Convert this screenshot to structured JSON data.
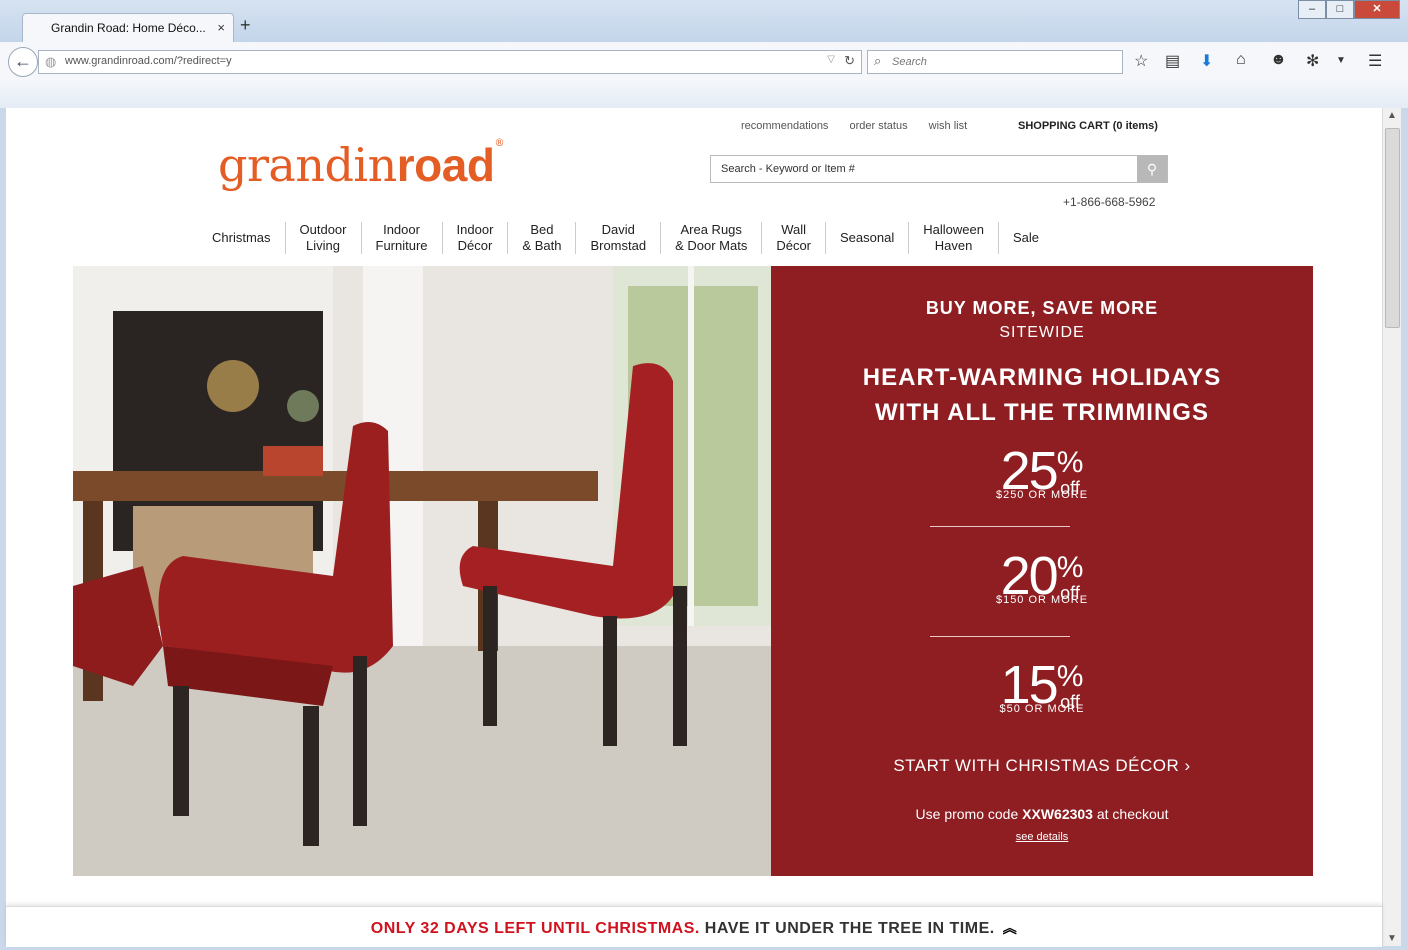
{
  "browser": {
    "tab_title": "Grandin Road: Home Déco...",
    "tab_close": "×",
    "new_tab": "+",
    "window_buttons": [
      "–",
      "□",
      "✕"
    ],
    "url": "www.grandinroad.com/?redirect=y",
    "search_placeholder": "Search",
    "icons": [
      "back-arrow-icon",
      "globe-icon",
      "reload-icon",
      "search-icon",
      "star-icon",
      "reading-list-icon",
      "download-icon",
      "home-icon",
      "chat-icon",
      "extension-icon",
      "menu-icon"
    ]
  },
  "site": {
    "top_links": [
      "recommendations",
      "order status",
      "wish list"
    ],
    "cart": "SHOPPING CART (0 items)",
    "logo_plain": "grandin",
    "logo_bold": "road",
    "logo_mark": "®",
    "search_placeholder": "Search - Keyword or Item #",
    "phone": "+1-866-668-5962",
    "categories": [
      {
        "line1": "Christmas",
        "line2": ""
      },
      {
        "line1": "Outdoor",
        "line2": "Living"
      },
      {
        "line1": "Indoor",
        "line2": "Furniture"
      },
      {
        "line1": "Indoor",
        "line2": "Décor"
      },
      {
        "line1": "Bed",
        "line2": "& Bath"
      },
      {
        "line1": "David",
        "line2": "Bromstad"
      },
      {
        "line1": "Area Rugs",
        "line2": "& Door Mats"
      },
      {
        "line1": "Wall",
        "line2": "Décor"
      },
      {
        "line1": "Seasonal",
        "line2": ""
      },
      {
        "line1": "Halloween",
        "line2": "Haven"
      },
      {
        "line1": "Sale",
        "line2": ""
      }
    ]
  },
  "promo": {
    "headline1": "BUY MORE, SAVE MORE",
    "headline2": "SITEWIDE",
    "headline3a": "HEART-WARMING HOLIDAYS",
    "headline3b": "WITH ALL THE TRIMMINGS",
    "tiers": [
      {
        "pct": "25",
        "sym": "%",
        "off": "off",
        "cond": "$250 OR MORE"
      },
      {
        "pct": "20",
        "sym": "%",
        "off": "off",
        "cond": "$150 OR MORE"
      },
      {
        "pct": "15",
        "sym": "%",
        "off": "off",
        "cond": "$50 OR MORE"
      }
    ],
    "cta": "START WITH CHRISTMAS DÉCOR ›",
    "code_prefix": "Use promo code ",
    "code": "XXW62303",
    "code_suffix": " at checkout",
    "details": "see details"
  },
  "footer": {
    "red": "ONLY 32 DAYS LEFT UNTIL CHRISTMAS.",
    "gray": " HAVE IT UNDER THE TREE IN TIME.",
    "chevron": "︽"
  },
  "colors": {
    "brand_orange": "#e35d25",
    "promo_red": "#8e1e22",
    "footer_red": "#d0121e"
  }
}
